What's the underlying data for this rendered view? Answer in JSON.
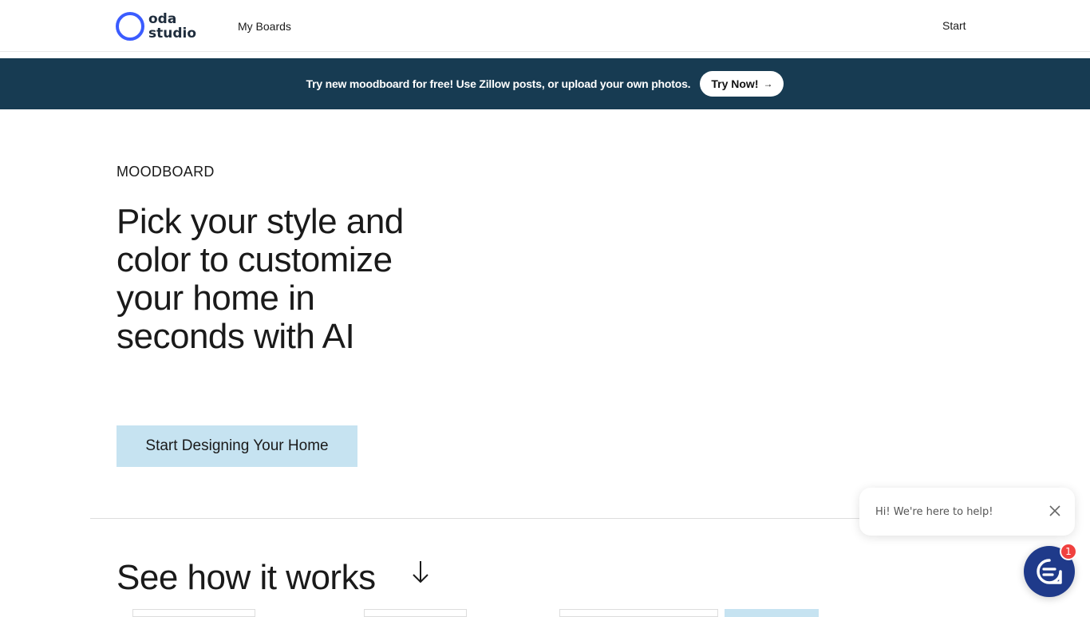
{
  "header": {
    "logo_line1": "oda",
    "logo_line2": "studio",
    "nav_boards": "My Boards",
    "nav_start": "Start"
  },
  "banner": {
    "text": "Try new moodboard for free! Use Zillow posts, or upload your own photos.",
    "button_label": "Try Now!",
    "button_arrow": "→"
  },
  "hero": {
    "eyebrow": "MOODBOARD",
    "title": "Pick your style and color to customize your home in seconds with AI",
    "cta_label": "Start Designing Your Home"
  },
  "how_it_works": {
    "title": "See how it works"
  },
  "chat": {
    "message": "Hi! We're here to help!",
    "badge_count": "1"
  },
  "colors": {
    "banner_bg": "#173b52",
    "cta_bg": "#c6e3f1",
    "logo_ring": "#3b5cff",
    "chat_launcher": "#1f3a8a",
    "badge": "#f0413f"
  },
  "icons": {
    "logo": "ring-logo-icon",
    "arrow": "arrow-right-icon",
    "down": "arrow-down-icon",
    "close": "close-icon",
    "chat": "chat-icon"
  }
}
